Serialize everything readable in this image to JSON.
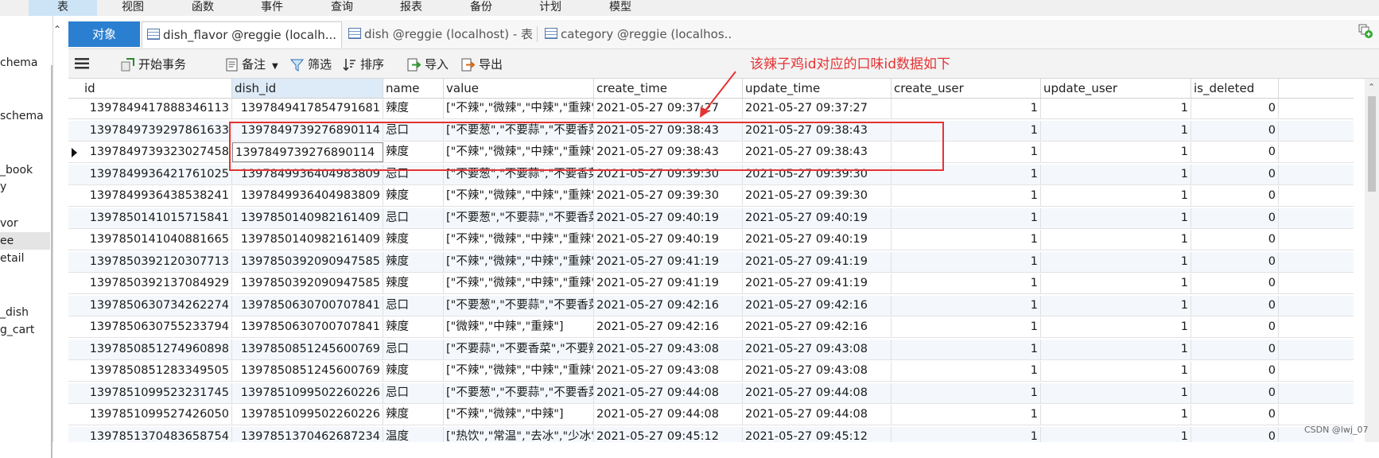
{
  "menu": [
    "表",
    "视图",
    "函数",
    "事件",
    "查询",
    "报表",
    "备份",
    "计划",
    "模型"
  ],
  "sidebar": [
    "chema",
    "schema",
    "_book",
    "y",
    "vor",
    "ee",
    "etail",
    "_dish",
    "g_cart"
  ],
  "tabs": {
    "object": "对象",
    "active": "dish_flavor @reggie (localh...",
    "tab2": "dish @reggie (localhost) - 表",
    "tab3": "category @reggie (localhos..."
  },
  "toolbar": {
    "begin_tx": "开始事务",
    "note": "备注",
    "filter": "筛选",
    "sort": "排序",
    "import": "导入",
    "export": "导出"
  },
  "columns": [
    "id",
    "dish_id",
    "name",
    "value",
    "create_time",
    "update_time",
    "create_user",
    "update_user",
    "is_deleted"
  ],
  "rows": [
    [
      "1397849417888346113",
      "1397849417854791681",
      "辣度",
      "[\"不辣\",\"微辣\",\"中辣\",\"重辣\"]",
      "2021-05-27 09:37:27",
      "2021-05-27 09:37:27",
      "1",
      "1",
      "0"
    ],
    [
      "1397849739297861633",
      "1397849739276890114",
      "忌口",
      "[\"不要葱\",\"不要蒜\",\"不要香菜\",\"不要辣\"]",
      "2021-05-27 09:38:43",
      "2021-05-27 09:38:43",
      "1",
      "1",
      "0"
    ],
    [
      "1397849739323027458",
      "1397849739276890114",
      "辣度",
      "[\"不辣\",\"微辣\",\"中辣\",\"重辣\"]",
      "2021-05-27 09:38:43",
      "2021-05-27 09:38:43",
      "1",
      "1",
      "0"
    ],
    [
      "1397849936421761025",
      "1397849936404983809",
      "忌口",
      "[\"不要葱\",\"不要蒜\",\"不要香菜\",\"不要辣\"]",
      "2021-05-27 09:39:30",
      "2021-05-27 09:39:30",
      "1",
      "1",
      "0"
    ],
    [
      "1397849936438538241",
      "1397849936404983809",
      "辣度",
      "[\"不辣\",\"微辣\",\"中辣\",\"重辣\"]",
      "2021-05-27 09:39:30",
      "2021-05-27 09:39:30",
      "1",
      "1",
      "0"
    ],
    [
      "1397850141015715841",
      "1397850140982161409",
      "忌口",
      "[\"不要葱\",\"不要蒜\",\"不要香菜\",\"不要辣\"]",
      "2021-05-27 09:40:19",
      "2021-05-27 09:40:19",
      "1",
      "1",
      "0"
    ],
    [
      "1397850141040881665",
      "1397850140982161409",
      "辣度",
      "[\"不辣\",\"微辣\",\"中辣\",\"重辣\"]",
      "2021-05-27 09:40:19",
      "2021-05-27 09:40:19",
      "1",
      "1",
      "0"
    ],
    [
      "1397850392120307713",
      "1397850392090947585",
      "辣度",
      "[\"不辣\",\"微辣\",\"中辣\",\"重辣\"]",
      "2021-05-27 09:41:19",
      "2021-05-27 09:41:19",
      "1",
      "1",
      "0"
    ],
    [
      "1397850392137084929",
      "1397850392090947585",
      "辣度",
      "[\"不辣\",\"微辣\",\"中辣\",\"重辣\"]",
      "2021-05-27 09:41:19",
      "2021-05-27 09:41:19",
      "1",
      "1",
      "0"
    ],
    [
      "1397850630734262274",
      "1397850630700707841",
      "忌口",
      "[\"不要葱\",\"不要蒜\",\"不要香菜\",\"不要辣\"]",
      "2021-05-27 09:42:16",
      "2021-05-27 09:42:16",
      "1",
      "1",
      "0"
    ],
    [
      "1397850630755233794",
      "1397850630700707841",
      "辣度",
      "[\"微辣\",\"中辣\",\"重辣\"]",
      "2021-05-27 09:42:16",
      "2021-05-27 09:42:16",
      "1",
      "1",
      "0"
    ],
    [
      "1397850851274960898",
      "1397850851245600769",
      "忌口",
      "[\"不要蒜\",\"不要香菜\",\"不要辣\"]",
      "2021-05-27 09:43:08",
      "2021-05-27 09:43:08",
      "1",
      "1",
      "0"
    ],
    [
      "1397850851283349505",
      "1397850851245600769",
      "辣度",
      "[\"不辣\",\"微辣\",\"中辣\",\"重辣\"]",
      "2021-05-27 09:43:08",
      "2021-05-27 09:43:08",
      "1",
      "1",
      "0"
    ],
    [
      "1397851099523231745",
      "1397851099502260226",
      "忌口",
      "[\"不要葱\",\"不要蒜\",\"不要香菜\",\"不要辣\"]",
      "2021-05-27 09:44:08",
      "2021-05-27 09:44:08",
      "1",
      "1",
      "0"
    ],
    [
      "1397851099527426050",
      "1397851099502260226",
      "辣度",
      "[\"不辣\",\"微辣\",\"中辣\"]",
      "2021-05-27 09:44:08",
      "2021-05-27 09:44:08",
      "1",
      "1",
      "0"
    ],
    [
      "1397851370483658754",
      "1397851370462687234",
      "温度",
      "[\"热饮\",\"常温\",\"去冰\",\"少冰\",\"多冰\"]",
      "2021-05-27 09:45:12",
      "2021-05-27 09:45:12",
      "1",
      "1",
      "0"
    ]
  ],
  "annotation": "该辣子鸡id对应的口味id数据如下",
  "watermark": "CSDN @lwj_07",
  "colors": {
    "accent": "#2b7fd0",
    "annotation": "#e53333"
  }
}
